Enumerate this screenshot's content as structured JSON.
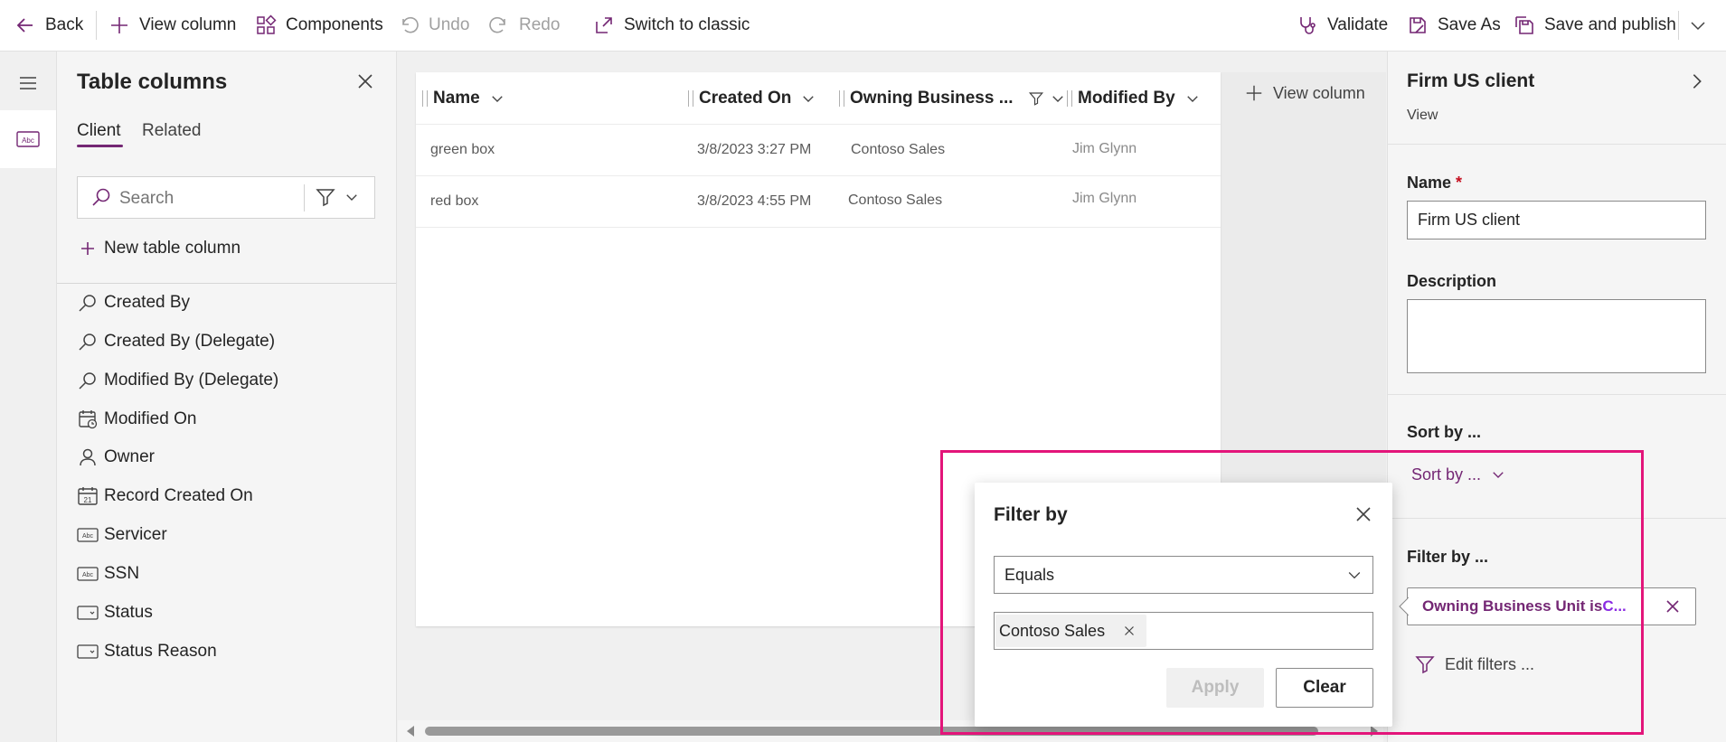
{
  "toolbar": {
    "back": "Back",
    "view_column": "View column",
    "components": "Components",
    "undo": "Undo",
    "redo": "Redo",
    "switch_classic": "Switch to classic",
    "validate": "Validate",
    "save_as": "Save As",
    "save_publish": "Save and publish"
  },
  "columns_panel": {
    "title": "Table columns",
    "tabs": [
      "Client",
      "Related"
    ],
    "active_tab": "Client",
    "search_placeholder": "Search",
    "new_column": "New table column",
    "items": [
      {
        "label": "Created By",
        "icon": "lookup-icon"
      },
      {
        "label": "Created By (Delegate)",
        "icon": "lookup-icon"
      },
      {
        "label": "Modified By (Delegate)",
        "icon": "lookup-icon"
      },
      {
        "label": "Modified On",
        "icon": "calendar-clock-icon"
      },
      {
        "label": "Owner",
        "icon": "person-icon"
      },
      {
        "label": "Record Created On",
        "icon": "calendar-date-icon"
      },
      {
        "label": "Servicer",
        "icon": "text-field-icon"
      },
      {
        "label": "SSN",
        "icon": "text-field-icon"
      },
      {
        "label": "Status",
        "icon": "option-set-icon"
      },
      {
        "label": "Status Reason",
        "icon": "option-set-icon"
      }
    ]
  },
  "grid": {
    "columns": [
      "Name",
      "Created On",
      "Owning Business ...",
      "Modified By"
    ],
    "rows": [
      {
        "name": "green box",
        "created_on": "3/8/2023 3:27 PM",
        "owning_bu": "Contoso Sales",
        "modified_by": "Jim Glynn"
      },
      {
        "name": "red box",
        "created_on": "3/8/2023 4:55 PM",
        "owning_bu": "Contoso Sales",
        "modified_by": "Jim Glynn"
      }
    ],
    "add_column": "View column"
  },
  "view_panel": {
    "title": "Firm US client",
    "subtitle": "View",
    "name_label": "Name",
    "required_mark": "*",
    "name_value": "Firm US client",
    "description_label": "Description",
    "description_value": "",
    "sort_label": "Sort by ...",
    "sort_dropdown": "Sort by ...",
    "filter_label": "Filter by ...",
    "filter_chip_prefix": "Owning Business Unit is ",
    "filter_chip_value": "C...",
    "edit_filters": "Edit filters ..."
  },
  "filter_popup": {
    "title": "Filter by",
    "operator": "Equals",
    "value_tag": "Contoso Sales",
    "apply": "Apply",
    "clear": "Clear"
  },
  "colors": {
    "accent": "#742774",
    "highlight": "#e3157a"
  }
}
